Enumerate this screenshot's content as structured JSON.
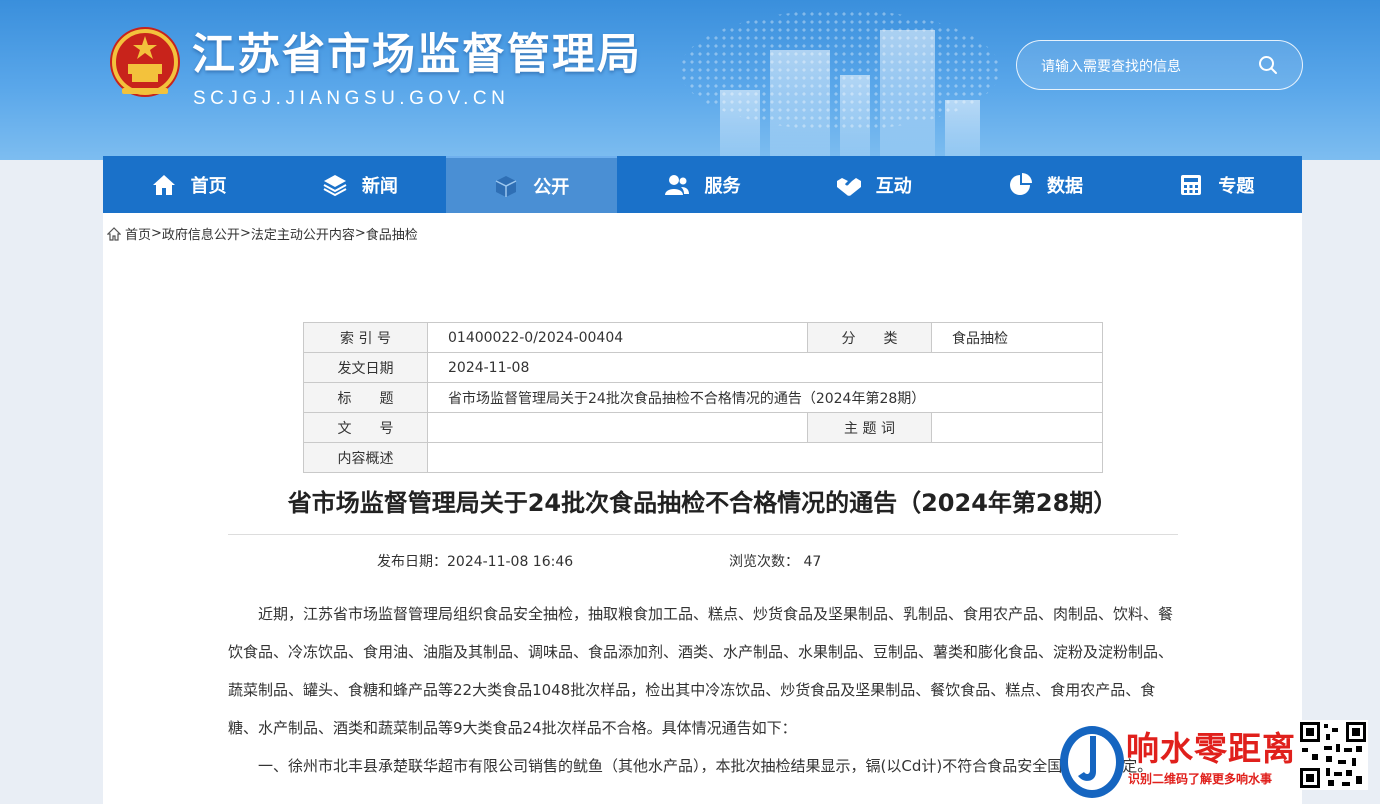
{
  "header": {
    "title": "江苏省市场监督管理局",
    "domain": "SCJGJ.JIANGSU.GOV.CN",
    "search_placeholder": "请输入需要查找的信息"
  },
  "nav": {
    "items": [
      {
        "label": "首页",
        "icon": "home-icon"
      },
      {
        "label": "新闻",
        "icon": "layers-icon"
      },
      {
        "label": "公开",
        "icon": "box-icon"
      },
      {
        "label": "服务",
        "icon": "users-icon"
      },
      {
        "label": "互动",
        "icon": "handshake-icon"
      },
      {
        "label": "数据",
        "icon": "pie-chart-icon"
      },
      {
        "label": "专题",
        "icon": "calculator-icon"
      }
    ],
    "active": "公开"
  },
  "breadcrumb": {
    "home": "首页",
    "items": [
      "政府信息公开",
      "法定主动公开内容",
      "食品抽检"
    ],
    "separator": ">"
  },
  "meta": {
    "index_label": "索 引 号",
    "index_value": "01400022-0/2024-00404",
    "category_label": "分　　类",
    "category_value": "食品抽检",
    "date_label": "发文日期",
    "date_value": "2024-11-08",
    "title_label": "标　　题",
    "title_value": "省市场监督管理局关于24批次食品抽检不合格情况的通告（2024年第28期）",
    "doc_no_label": "文　　号",
    "doc_no_value": "",
    "keywords_label": "主 题 词",
    "keywords_value": "",
    "summary_label": "内容概述",
    "summary_value": ""
  },
  "article": {
    "title": "省市场监督管理局关于24批次食品抽检不合格情况的通告（2024年第28期）",
    "publish_label": "发布日期：",
    "publish_value": "2024-11-08 16:46",
    "views_label": "浏览次数：",
    "views_value": "47",
    "paragraphs": [
      "近期，江苏省市场监督管理局组织食品安全抽检，抽取粮食加工品、糕点、炒货食品及坚果制品、乳制品、食用农产品、肉制品、饮料、餐饮食品、冷冻饮品、食用油、油脂及其制品、调味品、食品添加剂、酒类、水产制品、水果制品、豆制品、薯类和膨化食品、淀粉及淀粉制品、蔬菜制品、罐头、食糖和蜂产品等22大类食品1048批次样品，检出其中冷冻饮品、炒货食品及坚果制品、餐饮食品、糕点、食用农产品、食糖、水产制品、酒类和蔬菜制品等9大类食品24批次样品不合格。具体情况通告如下：",
      "一、徐州市北丰县承楚联华超市有限公司销售的鱿鱼（其他水产品），本批次抽检结果显示，镉(以Cd计)不符合食品安全国家标准规定。"
    ]
  },
  "watermark": {
    "title": "响水零距离",
    "subtitle": "识别二维码了解更多响水事"
  },
  "colors": {
    "nav_bg": "#1a71c9",
    "nav_active": "#4a8fd4",
    "banner": "#3a8fdc",
    "watermark_red": "#e0201c"
  }
}
